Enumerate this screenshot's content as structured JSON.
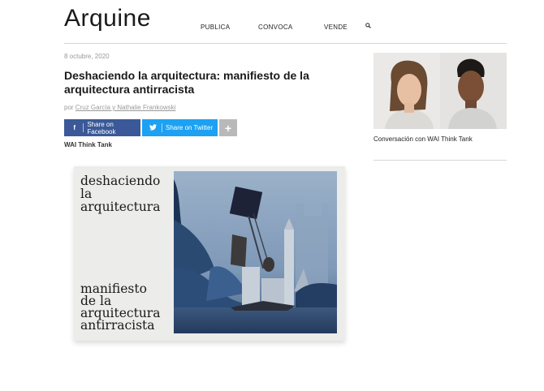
{
  "header": {
    "logo": "Arquine",
    "nav": [
      "PUBLICA",
      "CONVOCA",
      "VENDE"
    ],
    "search_icon": "search-icon"
  },
  "article": {
    "date": "8 octubre, 2020",
    "title": "Deshaciendo la arquitectura: manifiesto de la arquitectura antirracista",
    "byline_prefix": "por",
    "authors": "Cruz García y Nathalie Frankowski",
    "share": {
      "facebook": "Share on Facebook",
      "twitter": "Share on Twitter",
      "more": "+"
    },
    "source": "WAI Think Tank",
    "cover": {
      "line1": "deshaciendo",
      "line2": "la",
      "line3": "arquitectura",
      "line4": "manifiesto",
      "line5": "de la",
      "line6": "arquitectura",
      "line7": "antirracista"
    }
  },
  "sidebar": {
    "caption": "Conversación con WAI Think Tank"
  },
  "colors": {
    "facebook": "#3b5998",
    "twitter": "#1da1f2",
    "more": "#b9b9b9"
  }
}
